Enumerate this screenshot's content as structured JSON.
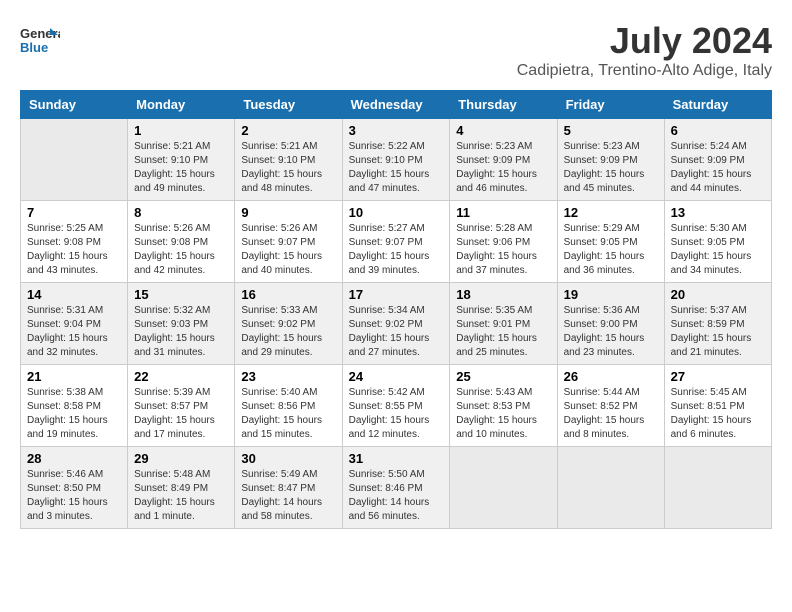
{
  "header": {
    "logo_line1": "General",
    "logo_line2": "Blue",
    "month_year": "July 2024",
    "location": "Cadipietra, Trentino-Alto Adige, Italy"
  },
  "weekdays": [
    "Sunday",
    "Monday",
    "Tuesday",
    "Wednesday",
    "Thursday",
    "Friday",
    "Saturday"
  ],
  "weeks": [
    [
      {
        "day": "",
        "detail": ""
      },
      {
        "day": "1",
        "detail": "Sunrise: 5:21 AM\nSunset: 9:10 PM\nDaylight: 15 hours\nand 49 minutes."
      },
      {
        "day": "2",
        "detail": "Sunrise: 5:21 AM\nSunset: 9:10 PM\nDaylight: 15 hours\nand 48 minutes."
      },
      {
        "day": "3",
        "detail": "Sunrise: 5:22 AM\nSunset: 9:10 PM\nDaylight: 15 hours\nand 47 minutes."
      },
      {
        "day": "4",
        "detail": "Sunrise: 5:23 AM\nSunset: 9:09 PM\nDaylight: 15 hours\nand 46 minutes."
      },
      {
        "day": "5",
        "detail": "Sunrise: 5:23 AM\nSunset: 9:09 PM\nDaylight: 15 hours\nand 45 minutes."
      },
      {
        "day": "6",
        "detail": "Sunrise: 5:24 AM\nSunset: 9:09 PM\nDaylight: 15 hours\nand 44 minutes."
      }
    ],
    [
      {
        "day": "7",
        "detail": "Sunrise: 5:25 AM\nSunset: 9:08 PM\nDaylight: 15 hours\nand 43 minutes."
      },
      {
        "day": "8",
        "detail": "Sunrise: 5:26 AM\nSunset: 9:08 PM\nDaylight: 15 hours\nand 42 minutes."
      },
      {
        "day": "9",
        "detail": "Sunrise: 5:26 AM\nSunset: 9:07 PM\nDaylight: 15 hours\nand 40 minutes."
      },
      {
        "day": "10",
        "detail": "Sunrise: 5:27 AM\nSunset: 9:07 PM\nDaylight: 15 hours\nand 39 minutes."
      },
      {
        "day": "11",
        "detail": "Sunrise: 5:28 AM\nSunset: 9:06 PM\nDaylight: 15 hours\nand 37 minutes."
      },
      {
        "day": "12",
        "detail": "Sunrise: 5:29 AM\nSunset: 9:05 PM\nDaylight: 15 hours\nand 36 minutes."
      },
      {
        "day": "13",
        "detail": "Sunrise: 5:30 AM\nSunset: 9:05 PM\nDaylight: 15 hours\nand 34 minutes."
      }
    ],
    [
      {
        "day": "14",
        "detail": "Sunrise: 5:31 AM\nSunset: 9:04 PM\nDaylight: 15 hours\nand 32 minutes."
      },
      {
        "day": "15",
        "detail": "Sunrise: 5:32 AM\nSunset: 9:03 PM\nDaylight: 15 hours\nand 31 minutes."
      },
      {
        "day": "16",
        "detail": "Sunrise: 5:33 AM\nSunset: 9:02 PM\nDaylight: 15 hours\nand 29 minutes."
      },
      {
        "day": "17",
        "detail": "Sunrise: 5:34 AM\nSunset: 9:02 PM\nDaylight: 15 hours\nand 27 minutes."
      },
      {
        "day": "18",
        "detail": "Sunrise: 5:35 AM\nSunset: 9:01 PM\nDaylight: 15 hours\nand 25 minutes."
      },
      {
        "day": "19",
        "detail": "Sunrise: 5:36 AM\nSunset: 9:00 PM\nDaylight: 15 hours\nand 23 minutes."
      },
      {
        "day": "20",
        "detail": "Sunrise: 5:37 AM\nSunset: 8:59 PM\nDaylight: 15 hours\nand 21 minutes."
      }
    ],
    [
      {
        "day": "21",
        "detail": "Sunrise: 5:38 AM\nSunset: 8:58 PM\nDaylight: 15 hours\nand 19 minutes."
      },
      {
        "day": "22",
        "detail": "Sunrise: 5:39 AM\nSunset: 8:57 PM\nDaylight: 15 hours\nand 17 minutes."
      },
      {
        "day": "23",
        "detail": "Sunrise: 5:40 AM\nSunset: 8:56 PM\nDaylight: 15 hours\nand 15 minutes."
      },
      {
        "day": "24",
        "detail": "Sunrise: 5:42 AM\nSunset: 8:55 PM\nDaylight: 15 hours\nand 12 minutes."
      },
      {
        "day": "25",
        "detail": "Sunrise: 5:43 AM\nSunset: 8:53 PM\nDaylight: 15 hours\nand 10 minutes."
      },
      {
        "day": "26",
        "detail": "Sunrise: 5:44 AM\nSunset: 8:52 PM\nDaylight: 15 hours\nand 8 minutes."
      },
      {
        "day": "27",
        "detail": "Sunrise: 5:45 AM\nSunset: 8:51 PM\nDaylight: 15 hours\nand 6 minutes."
      }
    ],
    [
      {
        "day": "28",
        "detail": "Sunrise: 5:46 AM\nSunset: 8:50 PM\nDaylight: 15 hours\nand 3 minutes."
      },
      {
        "day": "29",
        "detail": "Sunrise: 5:48 AM\nSunset: 8:49 PM\nDaylight: 15 hours\nand 1 minute."
      },
      {
        "day": "30",
        "detail": "Sunrise: 5:49 AM\nSunset: 8:47 PM\nDaylight: 14 hours\nand 58 minutes."
      },
      {
        "day": "31",
        "detail": "Sunrise: 5:50 AM\nSunset: 8:46 PM\nDaylight: 14 hours\nand 56 minutes."
      },
      {
        "day": "",
        "detail": ""
      },
      {
        "day": "",
        "detail": ""
      },
      {
        "day": "",
        "detail": ""
      }
    ]
  ]
}
